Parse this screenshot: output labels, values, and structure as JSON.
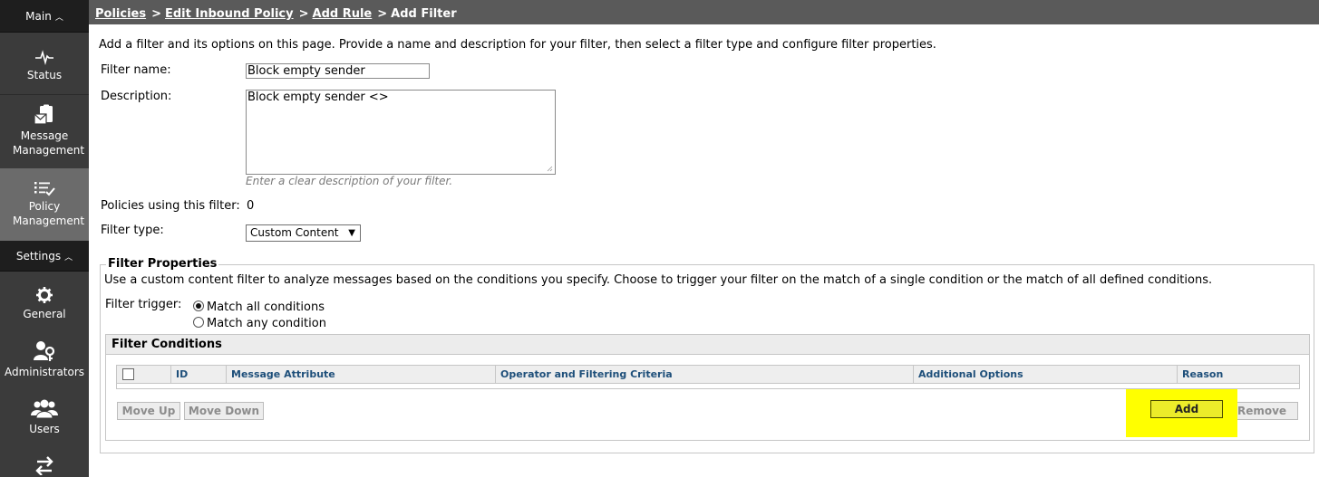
{
  "sidebar": {
    "main_label": "Main",
    "settings_label": "Settings",
    "items": [
      {
        "label": "Status",
        "icon": "pulse-icon"
      },
      {
        "label": "Message Management",
        "icon": "clipboard-mail-icon"
      },
      {
        "label": "Policy Management",
        "icon": "checklist-icon"
      },
      {
        "label": "General",
        "icon": "gear-icon"
      },
      {
        "label": "Administrators",
        "icon": "admin-key-icon"
      },
      {
        "label": "Users",
        "icon": "users-icon"
      }
    ]
  },
  "breadcrumb": {
    "items": [
      "Policies",
      "Edit Inbound Policy",
      "Add Rule"
    ],
    "current": "Add Filter",
    "separator": ">"
  },
  "page": {
    "intro": "Add a filter and its options on this page. Provide a name and description for your filter, then select a filter type and configure filter properties.",
    "filter_name_label": "Filter name:",
    "filter_name_value": "Block empty sender",
    "description_label": "Description:",
    "description_value": "Block empty sender <>",
    "description_hint": "Enter a clear description of your filter.",
    "policies_using_label": "Policies using this filter:",
    "policies_using_value": "0",
    "filter_type_label": "Filter type:",
    "filter_type_value": "Custom Content"
  },
  "filter_properties": {
    "legend": "Filter Properties",
    "description": "Use a custom content filter to analyze messages based on the conditions you specify. Choose to trigger your filter on the match of a single condition or the match of all defined conditions.",
    "trigger_label": "Filter trigger:",
    "trigger_options": [
      "Match all conditions",
      "Match any condition"
    ],
    "trigger_selected": "Match all conditions"
  },
  "filter_conditions": {
    "title": "Filter Conditions",
    "columns": [
      "ID",
      "Message Attribute",
      "Operator and Filtering Criteria",
      "Additional Options",
      "Reason"
    ],
    "rows": [],
    "buttons": {
      "move_up": "Move Up",
      "move_down": "Move Down",
      "add": "Add",
      "remove": "Remove"
    }
  },
  "colors": {
    "sidebar_bg": "#3b3b3b",
    "breadcrumb_bg": "#5a5a5a",
    "highlight": "#ffff00",
    "column_header_text": "#1e4f7a"
  }
}
